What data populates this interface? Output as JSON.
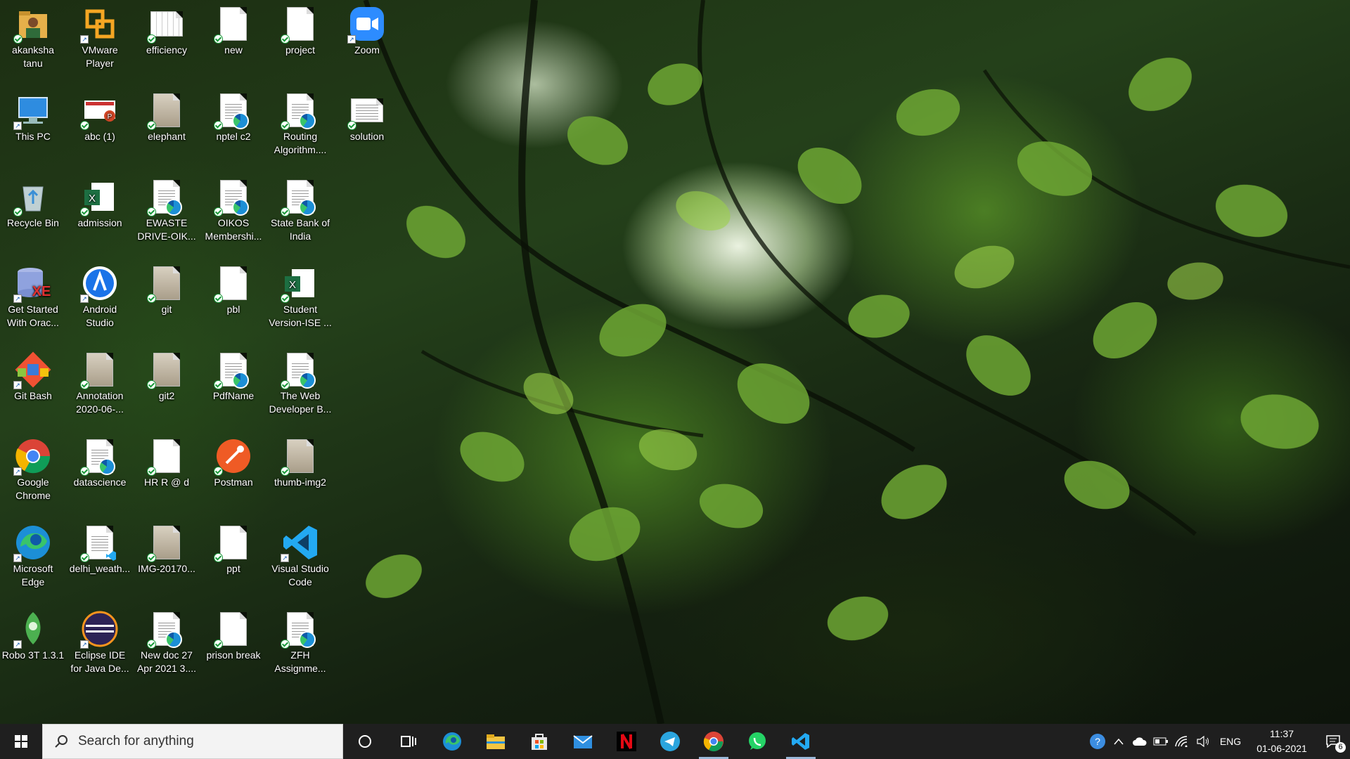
{
  "desktop": {
    "icons": [
      {
        "label": "akanksha tanu",
        "icon": "user-folder-icon"
      },
      {
        "label": "VMware Player",
        "icon": "vmware-icon"
      },
      {
        "label": "efficiency",
        "icon": "spreadsheet-file-icon"
      },
      {
        "label": "new",
        "icon": "blank-file-icon"
      },
      {
        "label": "project",
        "icon": "blank-file-icon"
      },
      {
        "label": "Zoom",
        "icon": "zoom-icon"
      },
      {
        "label": "This PC",
        "icon": "computer-icon"
      },
      {
        "label": "abc (1)",
        "icon": "powerpoint-file-icon"
      },
      {
        "label": "elephant",
        "icon": "image-file-icon"
      },
      {
        "label": "nptel c2",
        "icon": "pdf-edge-file-icon"
      },
      {
        "label": "Routing Algorithm....",
        "icon": "pdf-edge-file-icon"
      },
      {
        "label": "solution",
        "icon": "document-file-icon"
      },
      {
        "label": "Recycle Bin",
        "icon": "recycle-bin-icon"
      },
      {
        "label": "admission",
        "icon": "excel-file-icon"
      },
      {
        "label": "EWASTE DRIVE-OIK...",
        "icon": "pdf-edge-file-icon"
      },
      {
        "label": "OIKOS Membershi...",
        "icon": "pdf-edge-file-icon"
      },
      {
        "label": "State Bank of India",
        "icon": "pdf-edge-file-icon"
      },
      {
        "label": "Get Started With Orac...",
        "icon": "oracle-xe-icon"
      },
      {
        "label": "Android Studio",
        "icon": "android-studio-icon"
      },
      {
        "label": "git",
        "icon": "image-file-icon"
      },
      {
        "label": "pbl",
        "icon": "blank-file-icon"
      },
      {
        "label": "Student Version-ISE ...",
        "icon": "excel-file-icon"
      },
      {
        "label": "Git Bash",
        "icon": "git-bash-icon"
      },
      {
        "label": "Annotation 2020-06-...",
        "icon": "image-file-icon"
      },
      {
        "label": "git2",
        "icon": "image-file-icon"
      },
      {
        "label": "PdfName",
        "icon": "pdf-edge-file-icon"
      },
      {
        "label": "The Web Developer B...",
        "icon": "pdf-edge-file-icon"
      },
      {
        "label": "Google Chrome",
        "icon": "chrome-icon"
      },
      {
        "label": "datascience",
        "icon": "pdf-edge-file-icon"
      },
      {
        "label": "HR R @ d",
        "icon": "blank-file-icon"
      },
      {
        "label": "Postman",
        "icon": "postman-icon"
      },
      {
        "label": "thumb-img2",
        "icon": "image-file-icon"
      },
      {
        "label": "Microsoft Edge",
        "icon": "edge-icon"
      },
      {
        "label": "delhi_weath...",
        "icon": "vscode-file-icon"
      },
      {
        "label": "IMG-20170...",
        "icon": "image-file-icon"
      },
      {
        "label": "ppt",
        "icon": "blank-file-icon"
      },
      {
        "label": "Visual Studio Code",
        "icon": "vscode-icon"
      },
      {
        "label": "Robo 3T 1.3.1",
        "icon": "robo3t-icon"
      },
      {
        "label": "Eclipse IDE for Java De...",
        "icon": "eclipse-icon"
      },
      {
        "label": "New doc 27 Apr 2021 3....",
        "icon": "pdf-edge-file-icon"
      },
      {
        "label": "prison break",
        "icon": "blank-file-icon"
      },
      {
        "label": "ZFH Assignme...",
        "icon": "pdf-edge-file-icon"
      }
    ]
  },
  "taskbar": {
    "search_placeholder": "Search for anything",
    "apps": [
      {
        "name": "cortana-icon"
      },
      {
        "name": "task-view-icon"
      },
      {
        "name": "edge-icon"
      },
      {
        "name": "file-explorer-icon"
      },
      {
        "name": "microsoft-store-icon"
      },
      {
        "name": "mail-icon"
      },
      {
        "name": "netflix-icon"
      },
      {
        "name": "telegram-icon"
      },
      {
        "name": "chrome-icon",
        "active": true
      },
      {
        "name": "whatsapp-icon"
      },
      {
        "name": "vscode-icon",
        "active": true
      }
    ],
    "tray": {
      "language": "ENG",
      "time": "11:37",
      "date": "01-06-2021",
      "notification_count": "6"
    }
  }
}
